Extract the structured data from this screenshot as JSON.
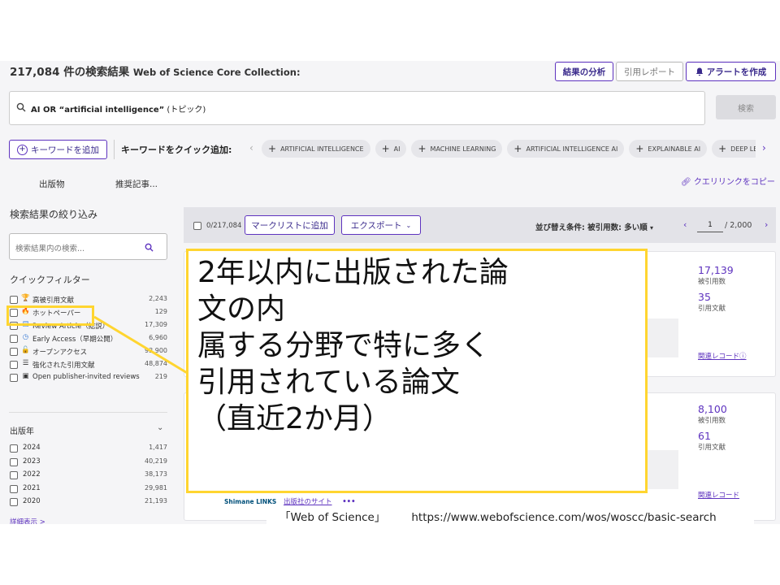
{
  "header": {
    "result_count": "217,084 件の検索結果",
    "database": "Web of Science Core Collection:",
    "buttons": {
      "analyze": "結果の分析",
      "citation_report": "引用レポート",
      "alert": "アラートを作成"
    }
  },
  "search": {
    "query_bold": "AI OR “artificial intelligence”",
    "query_field": " (トピック)",
    "button": "検索"
  },
  "keywords": {
    "add_button": "キーワードを追加",
    "quick_add_label": "キーワードをクイック追加:",
    "chips": [
      "ARTIFICIAL INTELLIGENCE",
      "AI",
      "MACHINE LEARNING",
      "ARTIFICIAL INTELLIGENCE AI",
      "EXPLAINABLE AI",
      "DEEP LEARNING"
    ]
  },
  "tabs": [
    "出版物",
    "推奨記事..."
  ],
  "copy_link": "クエリリンクをコピー",
  "refine": {
    "title": "検索結果の絞り込み",
    "search_placeholder": "検索結果内の検索...",
    "quick_filters_title": "クイックフィルター",
    "quick_filters": [
      {
        "icon": "trophy-icon",
        "glyph": "🏆",
        "color": "#b8860b",
        "label": "高被引用文献",
        "count": "2,243"
      },
      {
        "icon": "flame-icon",
        "glyph": "🔥",
        "color": "#e0431d",
        "label": "ホットペーパー",
        "count": "129"
      },
      {
        "icon": "document-icon",
        "glyph": "▤",
        "color": "#3a7bd5",
        "label": "Review Article（総説）",
        "count": "17,309"
      },
      {
        "icon": "clock-icon",
        "glyph": "◷",
        "color": "#3a7bd5",
        "label": "Early Access（早期公開）",
        "count": "6,960"
      },
      {
        "icon": "lock-open-icon",
        "glyph": "🔓",
        "color": "#333333",
        "label": "オープンアクセス",
        "count": "93,900"
      },
      {
        "icon": "enriched-refs-icon",
        "glyph": "☰",
        "color": "#333333",
        "label": "強化された引用文献",
        "count": "48,874"
      },
      {
        "icon": "book-icon",
        "glyph": "▣",
        "color": "#333333",
        "label": "Open publisher-invited reviews",
        "count": "219"
      }
    ],
    "year_title": "出版年",
    "years": [
      {
        "label": "2024",
        "count": "1,417"
      },
      {
        "label": "2023",
        "count": "40,219"
      },
      {
        "label": "2022",
        "count": "38,173"
      },
      {
        "label": "2021",
        "count": "29,981"
      },
      {
        "label": "2020",
        "count": "21,193"
      }
    ],
    "more": "詳細表示 >"
  },
  "results_toolbar": {
    "selected": "0/217,084",
    "marked_list": "マークリストに追加",
    "export": "エクスポート",
    "sort": "並び替え条件: 被引用数: 多い順",
    "page": "1",
    "total_pages": "/ 2,000"
  },
  "results": [
    {
      "times_cited": "17,139",
      "times_cited_label": "被引用数",
      "refs": "35",
      "refs_label": "引用文献",
      "related": "関連レコード"
    },
    {
      "times_cited": "8,100",
      "times_cited_label": "被引用数",
      "refs": "61",
      "refs_label": "引用文献",
      "related": "関連レコード",
      "links": "Shimane LINKS",
      "publisher_link": "出版社のサイト",
      "more": "•••"
    }
  ],
  "annotation": {
    "lines": [
      "2年以内に出版された論",
      "文の内",
      "属する分野で特に多く",
      "引用されている論文",
      "（直近2か月）"
    ],
    "highlight_color": "#ffd530"
  },
  "source": {
    "label": "「Web of Science」",
    "url": "https://www.webofscience.com/wos/woscc/basic-search"
  }
}
